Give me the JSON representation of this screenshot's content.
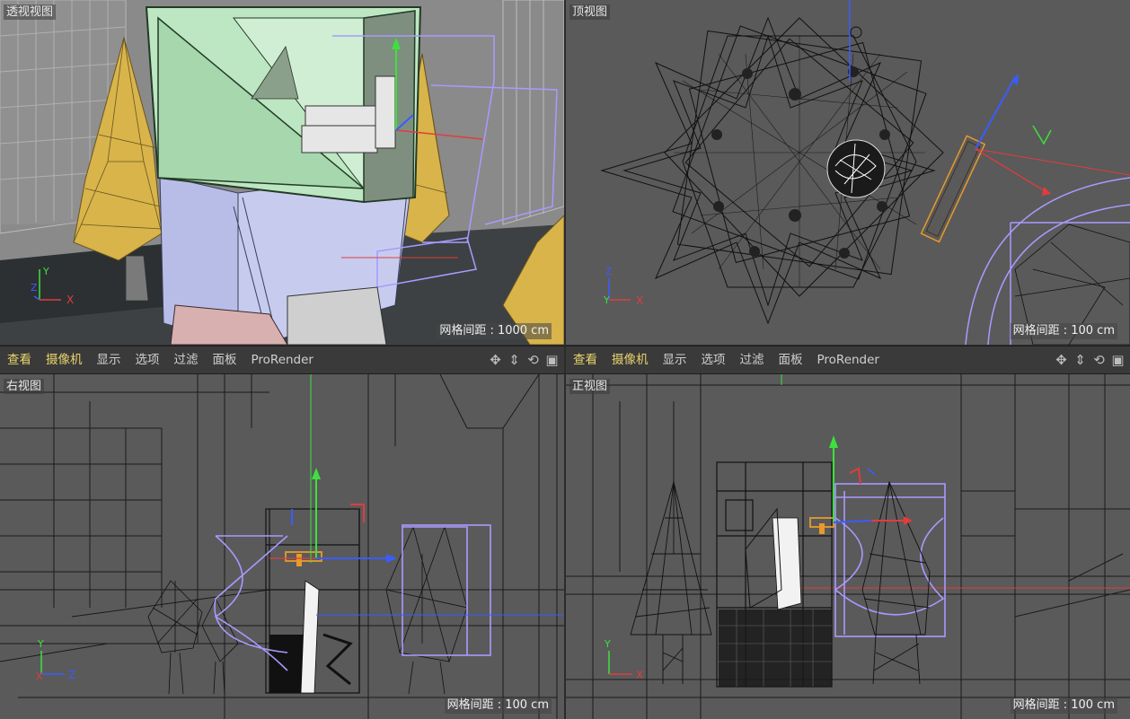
{
  "viewports": {
    "perspective": {
      "label": "透视视图",
      "grid_spacing": "网格间距 : 1000 cm"
    },
    "top": {
      "label": "顶视图",
      "grid_spacing": "网格间距 : 100 cm"
    },
    "right": {
      "label": "右视图",
      "grid_spacing": "网格间距 : 100 cm"
    },
    "front": {
      "label": "正视图",
      "grid_spacing": "网格间距 : 100 cm"
    }
  },
  "menubar": {
    "items": [
      "查看",
      "摄像机",
      "显示",
      "选项",
      "过滤",
      "面板",
      "ProRender"
    ],
    "tool_icons": [
      "move-view-icon",
      "dolly-view-icon",
      "rotate-view-icon",
      "toggle-layout-icon"
    ]
  },
  "axes": {
    "perspective": [
      "Y",
      "Z",
      "X"
    ],
    "top": [
      "Z",
      "Y",
      "X"
    ],
    "right": [
      "Y",
      "X",
      "Z"
    ],
    "front": [
      "Y",
      "X"
    ]
  },
  "colors": {
    "viewport_bg": "#5a5a5a",
    "menubar_bg": "#3a3a3a",
    "menu_active": "#e8d36a",
    "menu_text": "#cfcfcf",
    "axis_x": "#e23c3c",
    "axis_y": "#3ee03e",
    "axis_z": "#3a5cff",
    "selection_lavender": "#a99aff",
    "tree_yellow": "#d8b44a",
    "box_green": "#bde6c2",
    "box_blue": "#b8bde8"
  }
}
